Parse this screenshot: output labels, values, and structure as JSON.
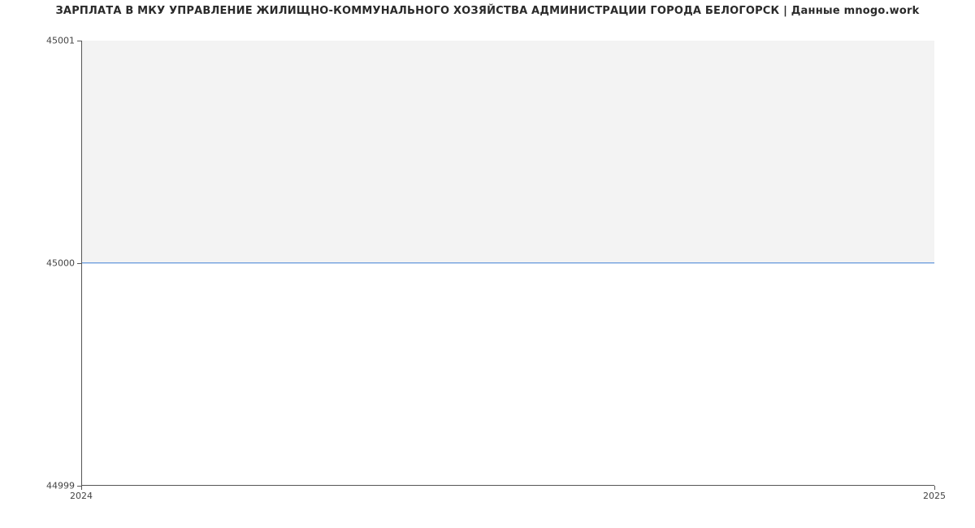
{
  "chart_data": {
    "type": "line",
    "title": "ЗАРПЛАТА В МКУ  УПРАВЛЕНИЕ ЖИЛИЩНО-КОММУНАЛЬНОГО ХОЗЯЙСТВА АДМИНИСТРАЦИИ ГОРОДА БЕЛОГОРСК | Данные mnogo.work",
    "xlabel": "",
    "ylabel": "",
    "x": [
      2024,
      2025
    ],
    "series": [
      {
        "name": "salary",
        "values": [
          45000,
          45000
        ],
        "color": "#3f7fd6"
      }
    ],
    "x_ticks": [
      "2024",
      "2025"
    ],
    "y_ticks": [
      "45001",
      "45000",
      "44999"
    ],
    "xlim": [
      2024,
      2025
    ],
    "ylim": [
      44999,
      45001
    ],
    "grid": false
  }
}
